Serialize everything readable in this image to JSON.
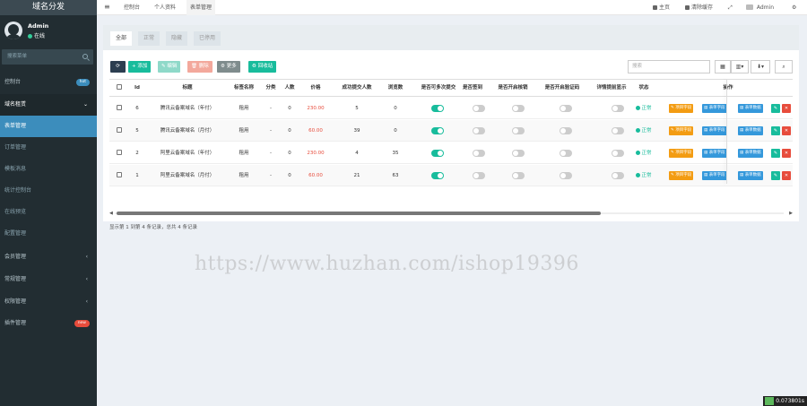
{
  "sidebar": {
    "brand": "域名分发",
    "user": {
      "name": "Admin",
      "status": "在线"
    },
    "search_placeholder": "搜索菜单",
    "items": [
      {
        "label": "控制台",
        "badge": "hot",
        "badge_color": "#3c8dbc"
      },
      {
        "label": "域名租赁"
      },
      {
        "label": "表单管理"
      },
      {
        "label": "订单管理"
      },
      {
        "label": "模板消息"
      },
      {
        "label": "统计控制台"
      },
      {
        "label": "在线预览"
      },
      {
        "label": "配置管理"
      },
      {
        "label": "会员管理"
      },
      {
        "label": "常规管理"
      },
      {
        "label": "权限管理"
      },
      {
        "label": "插件管理",
        "badge": "new",
        "badge_color": "#e74c3c"
      }
    ]
  },
  "topbar": {
    "tabs": [
      "控制台",
      "个人资料",
      "表单管理"
    ],
    "home": "主页",
    "clear_cache": "清除缓存",
    "user": "Admin"
  },
  "panel": {
    "tabs": [
      "全部",
      "正常",
      "隐藏",
      "已停用"
    ],
    "buttons": {
      "refresh": "",
      "add": "+ 添加",
      "edit": "编辑",
      "delete": "删除",
      "more": "更多",
      "recycle": "回收站"
    },
    "search_placeholder": "搜索"
  },
  "table": {
    "headers": [
      "Id",
      "标题",
      "标签名称",
      "分类",
      "人数",
      "价格",
      "成功提交人数",
      "浏览数",
      "是否可多次提交",
      "是否签到",
      "是否开启核销",
      "是否开启验证码",
      "详情提前显示",
      "状态",
      "操作"
    ],
    "rows": [
      {
        "id": "6",
        "title": "腾讯云备案域名（年付）",
        "tag": "租用",
        "category": "-",
        "people": "0",
        "price": "230.00",
        "success": "5",
        "views": "0",
        "multi": true,
        "sign": false,
        "verify": false,
        "captcha": false,
        "detail": false,
        "status": "正常"
      },
      {
        "id": "5",
        "title": "腾讯云备案域名（月付）",
        "tag": "租用",
        "category": "-",
        "people": "0",
        "price": "60.00",
        "success": "39",
        "views": "0",
        "multi": true,
        "sign": false,
        "verify": false,
        "captcha": false,
        "detail": false,
        "status": "正常"
      },
      {
        "id": "2",
        "title": "阿里云备案域名（年付）",
        "tag": "租用",
        "category": "-",
        "people": "0",
        "price": "230.00",
        "success": "4",
        "views": "35",
        "multi": true,
        "sign": false,
        "verify": false,
        "captcha": false,
        "detail": false,
        "status": "正常"
      },
      {
        "id": "1",
        "title": "阿里云备案域名（月付）",
        "tag": "租用",
        "category": "-",
        "people": "0",
        "price": "60.00",
        "success": "21",
        "views": "63",
        "multi": true,
        "sign": false,
        "verify": false,
        "captcha": false,
        "detail": false,
        "status": "正常"
      }
    ],
    "row_actions": {
      "project": "项目字段",
      "form": "表单字段",
      "data": "表单数据"
    }
  },
  "pager": "显示第 1 到第 4 条记录，总共 4 条记录",
  "watermark": "https://www.huzhan.com/ishop19396",
  "timer": "0.073801s"
}
